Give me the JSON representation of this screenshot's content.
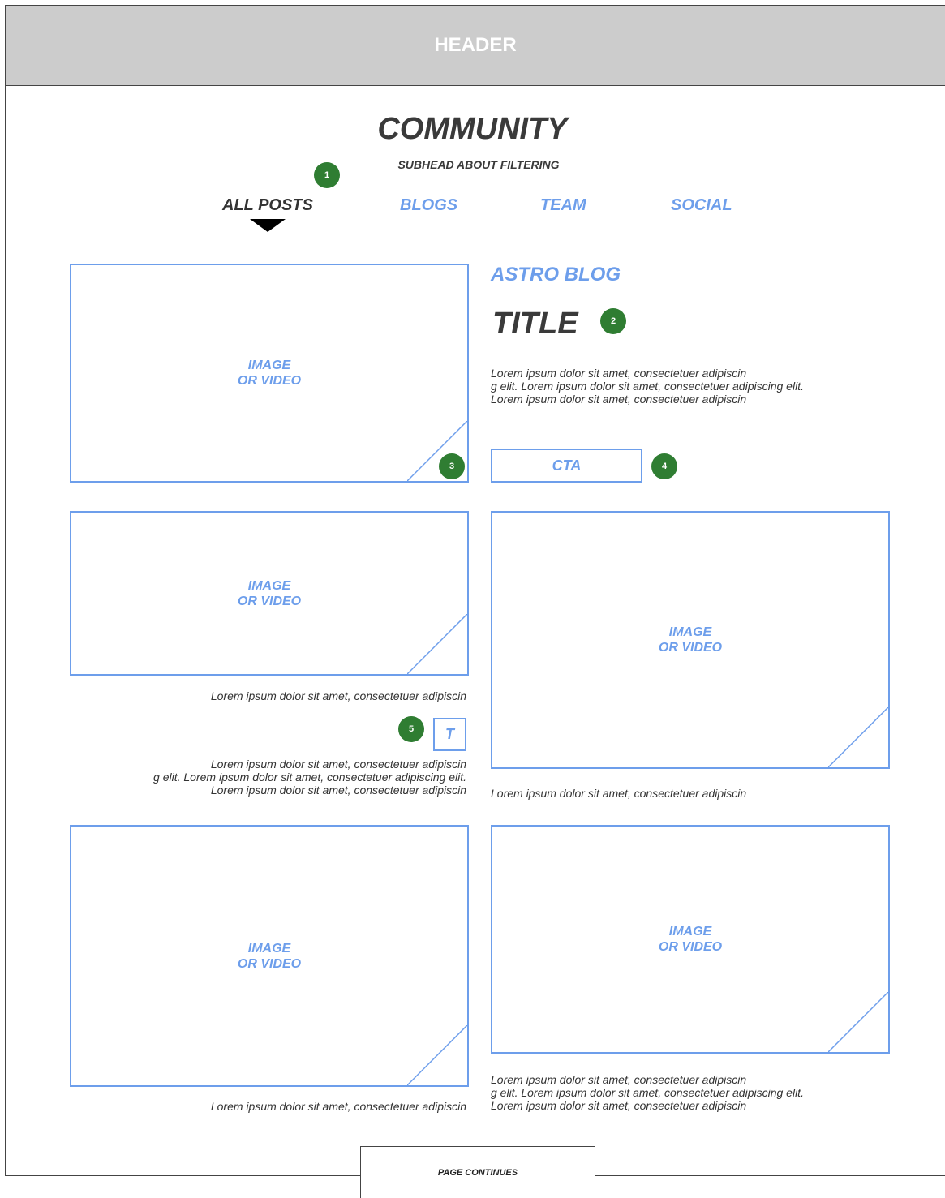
{
  "header": {
    "label": "HEADER"
  },
  "page": {
    "title": "COMMUNITY",
    "subhead": "SUBHEAD ABOUT FILTERING"
  },
  "tabs": [
    {
      "label": "ALL POSTS",
      "active": true
    },
    {
      "label": "BLOGS",
      "active": false
    },
    {
      "label": "TEAM",
      "active": false
    },
    {
      "label": "SOCIAL",
      "active": false
    }
  ],
  "annotations": [
    "1",
    "2",
    "3",
    "4",
    "5"
  ],
  "media_label": {
    "line1": "IMAGE",
    "line2": "OR VIDEO"
  },
  "featured": {
    "category": "ASTRO BLOG",
    "title": "TITLE",
    "excerpt": "Lorem ipsum dolor sit amet, consectetuer adipiscin\ng elit. Lorem ipsum dolor sit amet, consectetuer adipiscing elit.\nLorem ipsum dolor sit amet, consectetuer adipiscin",
    "cta": "CTA"
  },
  "cards": [
    {
      "caption": "Lorem ipsum dolor sit amet, consectetuer adipiscin",
      "icon_label": "T",
      "body": "Lorem ipsum dolor sit amet, consectetuer adipiscin\ng elit. Lorem ipsum dolor sit amet, consectetuer adipiscing elit.\nLorem ipsum dolor sit amet, consectetuer adipiscin"
    },
    {
      "caption": "Lorem ipsum dolor sit amet, consectetuer adipiscin"
    },
    {
      "caption": "Lorem ipsum dolor sit amet, consectetuer adipiscin"
    },
    {
      "caption": "Lorem ipsum dolor sit amet, consectetuer adipiscin\ng elit. Lorem ipsum dolor sit amet, consectetuer adipiscing elit.\nLorem ipsum dolor sit amet, consectetuer adipiscin"
    }
  ],
  "footer": {
    "label": "PAGE CONTINUES"
  },
  "colors": {
    "accent": "#6d9eeb",
    "badge": "#2f7d32",
    "header_bg": "#cccccc",
    "text": "#3a3a3a"
  }
}
